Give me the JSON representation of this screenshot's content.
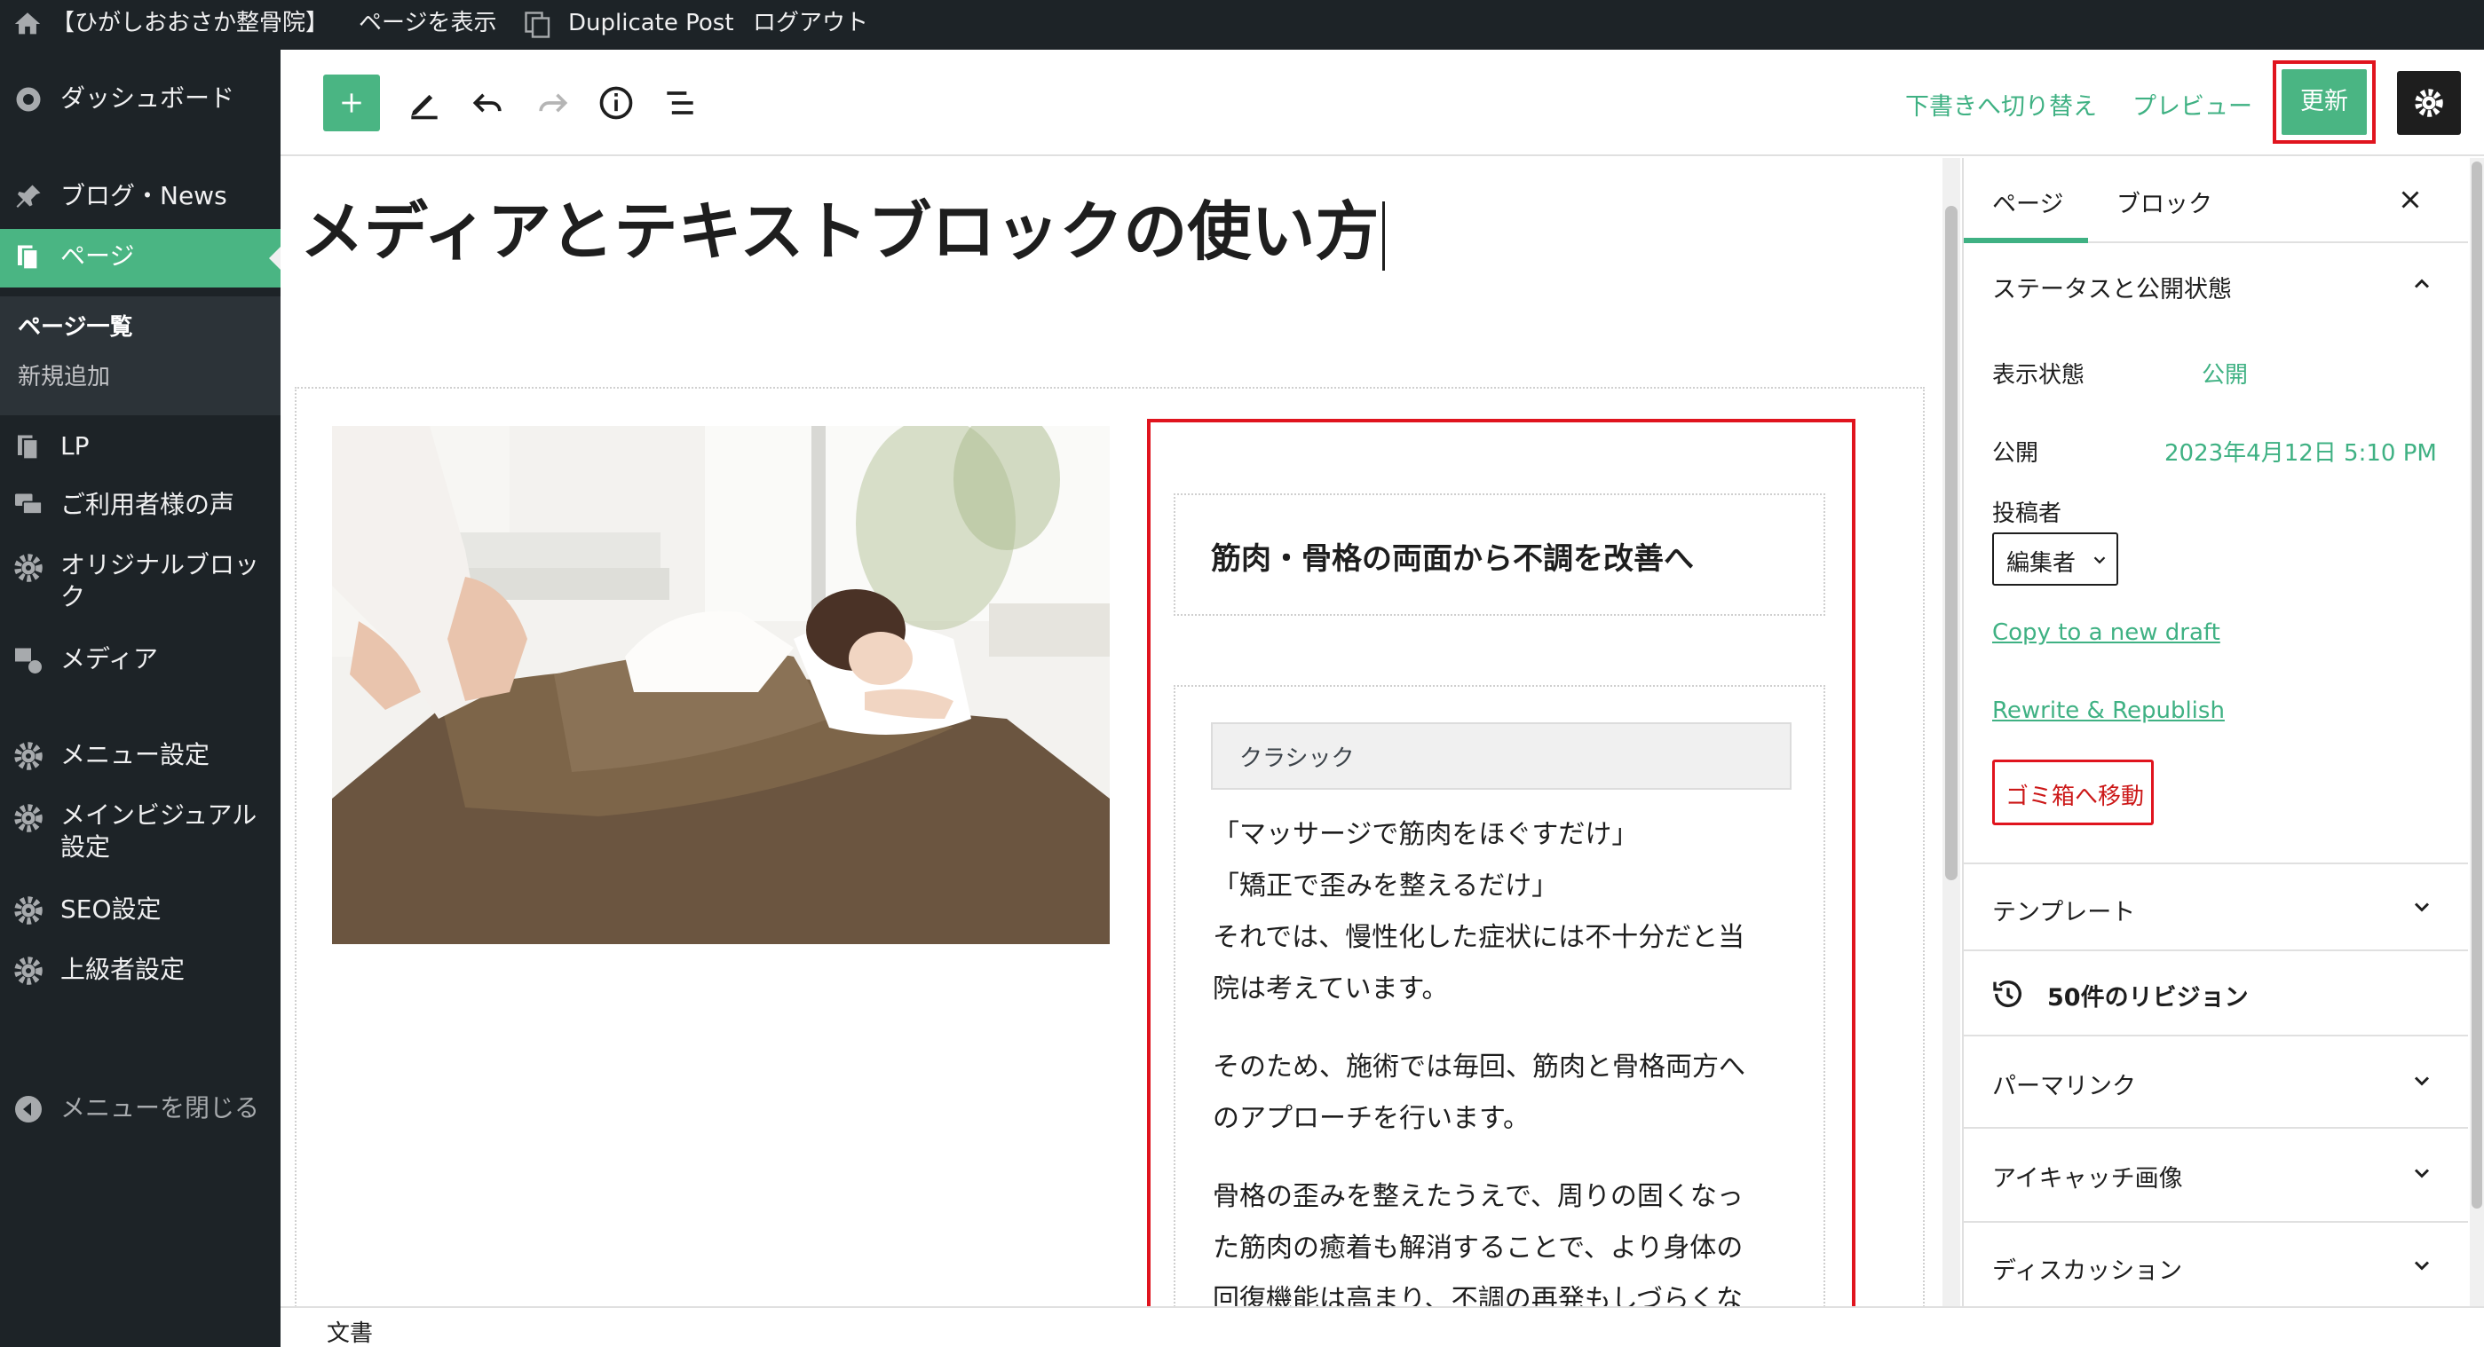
{
  "admin_bar": {
    "site_name": "【ひがしおおさか整骨院】",
    "view_page": "ページを表示",
    "duplicate_post": "Duplicate Post",
    "logout": "ログアウト"
  },
  "sidebar": {
    "items": [
      {
        "label": "ダッシュボード",
        "icon": "gauge-icon"
      },
      {
        "label": "ブログ・News",
        "icon": "pin-icon"
      },
      {
        "label": "ページ",
        "icon": "pages-icon"
      },
      {
        "label": "LP",
        "icon": "pages-icon"
      },
      {
        "label": "ご利用者様の声",
        "icon": "comments-icon"
      },
      {
        "label": "オリジナルブロック",
        "label_line1": "オリジナルブロッ",
        "label_line2": "ク",
        "icon": "gear-icon"
      },
      {
        "label": "メディア",
        "icon": "media-icon"
      },
      {
        "label": "メニュー設定",
        "icon": "gear-icon"
      },
      {
        "label": "メインビジュアル設定",
        "label_line1": "メインビジュアル",
        "label_line2": "設定",
        "icon": "gear-icon"
      },
      {
        "label": "SEO設定",
        "icon": "gear-icon"
      },
      {
        "label": "上級者設定",
        "icon": "gear-icon"
      }
    ],
    "submenu": {
      "all_pages": "ページ一覧",
      "add_new": "新規追加"
    },
    "collapse": "メニューを閉じる"
  },
  "toolbar": {
    "switch_draft": "下書きへ切り替え",
    "preview": "プレビュー",
    "update": "更新"
  },
  "editor": {
    "title": "メディアとテキストブロックの使い方",
    "heading": "筋肉・骨格の両面から不調を改善へ",
    "classic_label": "クラシック",
    "lines": [
      "「マッサージで筋肉をほぐすだけ」",
      "「矯正で歪みを整えるだけ」",
      "それでは、慢性化した症状には不十分だと当",
      "院は考えています。"
    ],
    "para2": [
      "そのため、施術では毎回、筋肉と骨格両方へ",
      "のアプローチを行います。"
    ],
    "para3": [
      "骨格の歪みを整えたうえで、周りの固くなっ",
      "た筋肉の癒着も解消することで、より身体の",
      "回復機能は高まり、不調の再発もしづらくな"
    ]
  },
  "footer": {
    "breadcrumb": "文書"
  },
  "panel": {
    "tabs": {
      "page": "ページ",
      "block": "ブロック"
    },
    "status": {
      "title": "ステータスと公開状態",
      "visibility_label": "表示状態",
      "visibility_value": "公開",
      "publish_label": "公開",
      "publish_value": "2023年4月12日 5:10 PM",
      "author_label": "投稿者",
      "author_value": "編集者",
      "copy_draft": "Copy to a new draft",
      "rewrite": "Rewrite & Republish",
      "trash": "ゴミ箱へ移動"
    },
    "template": "テンプレート",
    "revisions": "50件のリビジョン",
    "permalink": "パーマリンク",
    "featured_image": "アイキャッチ画像",
    "discussion": "ディスカッション"
  },
  "colors": {
    "accent": "#3fb183",
    "highlight": "#e0141e",
    "dark": "#1d2327"
  }
}
